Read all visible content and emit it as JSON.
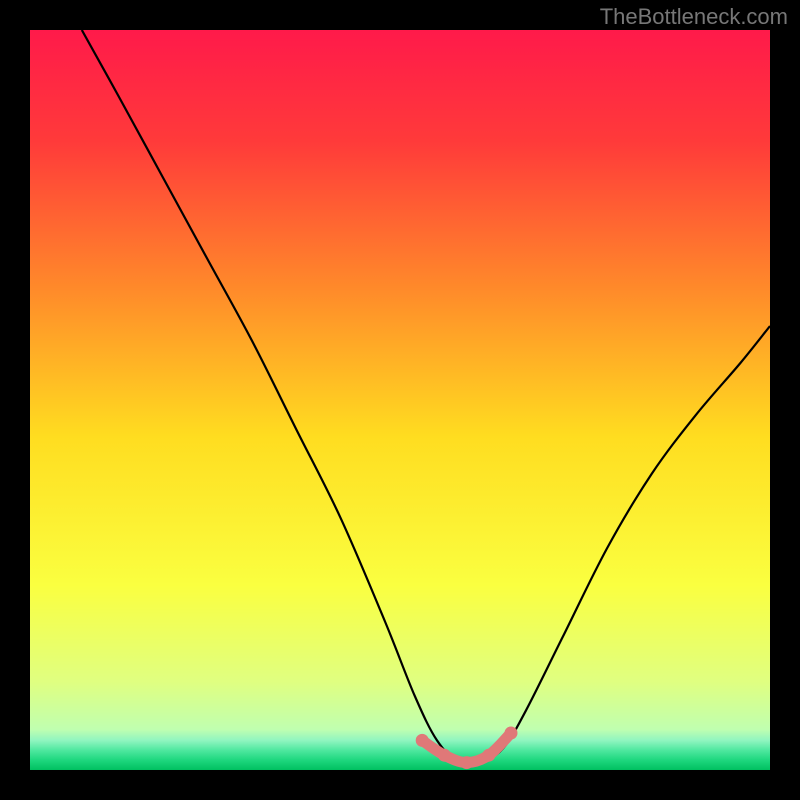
{
  "watermark": "TheBottleneck.com",
  "chart_data": {
    "type": "line",
    "title": "",
    "xlabel": "",
    "ylabel": "",
    "xlim": [
      0,
      100
    ],
    "ylim": [
      0,
      100
    ],
    "series": [
      {
        "name": "bottleneck-curve",
        "color": "#000000",
        "x": [
          7,
          12,
          18,
          24,
          30,
          36,
          42,
          48,
          52,
          55,
          58,
          61,
          64,
          67,
          72,
          78,
          84,
          90,
          96,
          100
        ],
        "y": [
          100,
          91,
          80,
          69,
          58,
          46,
          34,
          20,
          10,
          4,
          1,
          1,
          3,
          8,
          18,
          30,
          40,
          48,
          55,
          60
        ]
      }
    ],
    "highlight": {
      "name": "optimal-zone",
      "color": "#e07878",
      "x": [
        53,
        56,
        59,
        62,
        65
      ],
      "y": [
        4,
        2,
        1,
        2,
        5
      ]
    },
    "background_gradient": [
      {
        "pos": 0.0,
        "color": "#ff1a4a"
      },
      {
        "pos": 0.15,
        "color": "#ff3a3a"
      },
      {
        "pos": 0.35,
        "color": "#ff8a2a"
      },
      {
        "pos": 0.55,
        "color": "#ffdd20"
      },
      {
        "pos": 0.75,
        "color": "#faff40"
      },
      {
        "pos": 0.88,
        "color": "#e0ff80"
      },
      {
        "pos": 0.945,
        "color": "#c0ffb0"
      },
      {
        "pos": 0.96,
        "color": "#90f5c0"
      },
      {
        "pos": 0.973,
        "color": "#50e8a0"
      },
      {
        "pos": 0.986,
        "color": "#20d880"
      },
      {
        "pos": 1.0,
        "color": "#00c060"
      }
    ]
  }
}
